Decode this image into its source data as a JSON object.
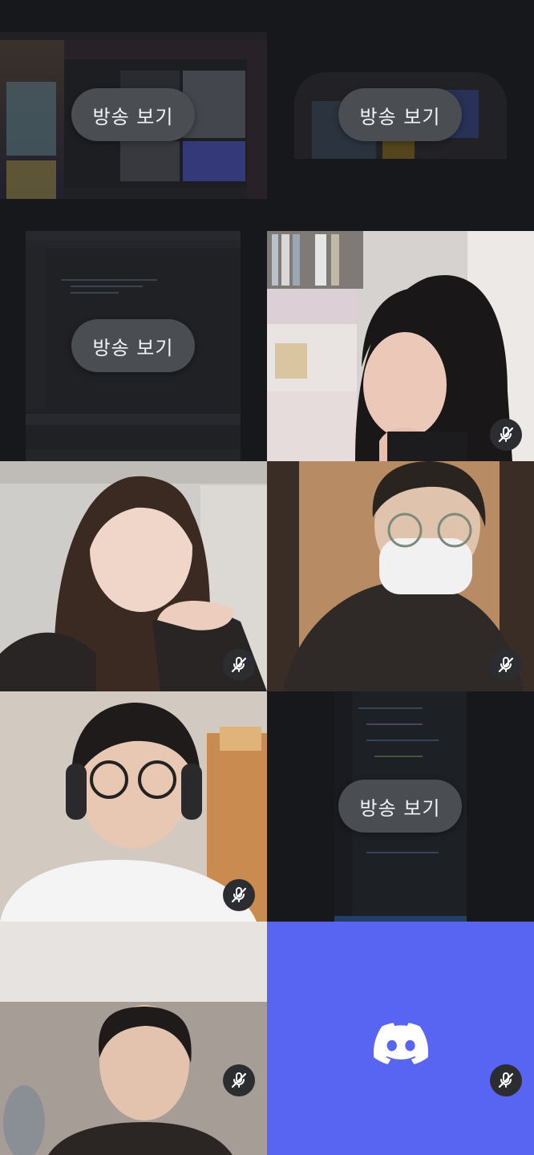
{
  "stream_button_label": "방송 보기",
  "colors": {
    "background": "#17181b",
    "button_bg": "#4a4d52",
    "discord_blurple": "#5865f2",
    "speaking_dot": "#2dc770",
    "mute_badge_bg": "#2b2d31"
  },
  "tiles": [
    {
      "kind": "screen-share"
    },
    {
      "kind": "screen-share"
    },
    {
      "kind": "screen-share"
    },
    {
      "kind": "camera",
      "muted": true
    },
    {
      "kind": "camera",
      "muted": true
    },
    {
      "kind": "camera",
      "muted": true
    },
    {
      "kind": "camera",
      "muted": true
    },
    {
      "kind": "screen-share"
    },
    {
      "kind": "camera",
      "muted": true
    },
    {
      "kind": "avatar",
      "icon": "discord-logo-icon",
      "muted": true
    }
  ],
  "icons": {
    "mute": "microphone-slash-icon",
    "avatar": "discord-logo-icon"
  }
}
